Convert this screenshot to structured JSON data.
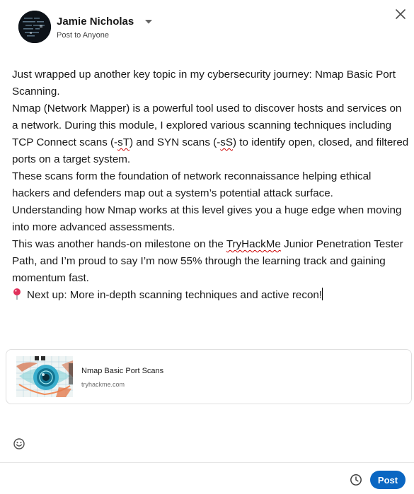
{
  "author": {
    "name": "Jamie Nicholas",
    "audience": "Post to Anyone"
  },
  "post_text": {
    "line1": "Just wrapped up another key topic in my cybersecurity journey: Nmap Basic Port Scanning.",
    "p2_a": "Nmap (Network Mapper) is a powerful tool used to discover hosts and services on a network. During this module, I explored various scanning techniques including TCP Connect scans (-",
    "p2_st": "sT",
    "p2_b": ") and SYN scans (-",
    "p2_ss": "sS",
    "p2_c": ") to identify open, closed, and filtered ports on a target system.",
    "p3": "These scans form the foundation of network reconnaissance helping ethical hackers and defenders map out a system’s potential attack surface.",
    "p4": "Understanding how Nmap works at this level gives you a huge edge when moving into more advanced assessments.",
    "p5_a": "This was another hands-on milestone on the ",
    "p5_brand": "TryHackMe",
    "p5_b": " Junior Penetration Tester Path, and I’m proud to say I’m now 55% through the learning track and gaining momentum fast.",
    "p6": "Next up: More in-depth scanning techniques and active recon!"
  },
  "link_preview": {
    "title": "Nmap Basic Port Scans",
    "domain": "tryhackme.com"
  },
  "footer": {
    "post_label": "Post"
  },
  "icons": {
    "close": "close-icon",
    "caret": "caret-down-icon",
    "pin": "round-pushpin-icon",
    "emoji": "emoji-icon",
    "schedule": "clock-icon"
  },
  "colors": {
    "primary": "#0a66c2",
    "spellcheck": "#cc0000"
  }
}
